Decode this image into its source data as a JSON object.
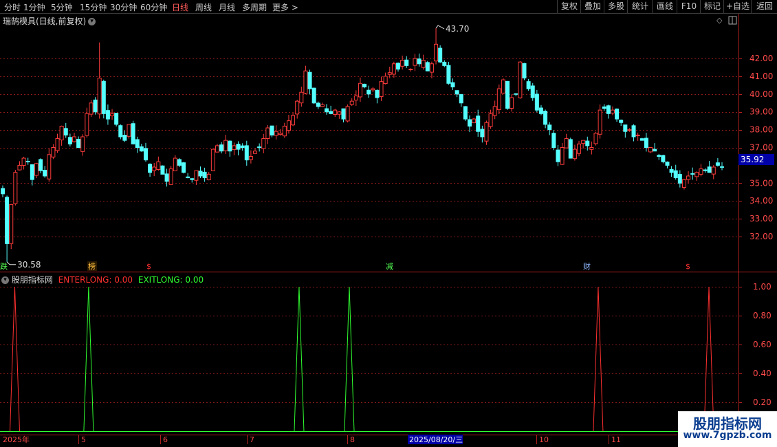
{
  "toolbar": {
    "periods": [
      "分时",
      "1分钟",
      "5分钟",
      "15分钟",
      "30分钟",
      "60分钟",
      "日线",
      "周线",
      "月线",
      "多周期",
      "更多 >"
    ],
    "active_period": "日线",
    "right_buttons": [
      "复权",
      "叠加",
      "多股",
      "统计",
      "画线",
      "F10",
      "标记",
      "+自选",
      "返回"
    ]
  },
  "main_chart": {
    "title": "瑞鹄模具(日线,前复权)",
    "y_axis_labels": [
      "42.00",
      "41.00",
      "40.00",
      "39.00",
      "38.00",
      "37.00",
      "35.00",
      "34.00",
      "33.00",
      "32.00"
    ],
    "high_label": "43.70",
    "low_label": "30.58",
    "current_price": "35.92",
    "event_markers": [
      "跌",
      "榜",
      "$",
      "减",
      "财",
      "$"
    ],
    "colors": {
      "up": "#ff3c3c",
      "down": "#54ffff",
      "grid": "#8b1a1a",
      "axis": "#b02020",
      "current_bg": "#0000a8"
    }
  },
  "indicator": {
    "name": "股朋指标网",
    "enter_label": "ENTERLONG: 0.00",
    "exit_label": "EXITLONG: 0.00",
    "y_axis_labels": [
      "1.00",
      "0.80",
      "0.60",
      "0.40",
      "0.20"
    ],
    "enter_color": "#ff3030",
    "exit_color": "#30ff30"
  },
  "time_axis": {
    "labels": [
      "2025年",
      "5",
      "6",
      "7",
      "8",
      "10",
      "11"
    ],
    "cursor_date": "2025/08/20/三"
  },
  "watermark": {
    "line1": "股朋指标网",
    "line2": "www.7gpzb.com"
  },
  "chart_data": {
    "type": "candlestick",
    "title": "瑞鹄模具(日线,前复权)",
    "ylim": [
      30.3,
      44.0
    ],
    "y_ticks": [
      32,
      33,
      34,
      35,
      37,
      38,
      39,
      40,
      41,
      42
    ],
    "period_high": 43.7,
    "period_low": 30.58,
    "last_price": 35.92,
    "close_series": [
      34.4,
      31.6,
      33.8,
      35.6,
      36.0,
      36.4,
      36.2,
      35.2,
      36.1,
      35.7,
      35.4,
      36.6,
      37.0,
      37.5,
      38.2,
      37.7,
      37.2,
      37.6,
      37.0,
      37.6,
      38.9,
      39.5,
      39.0,
      40.9,
      38.9,
      38.6,
      38.9,
      38.3,
      37.6,
      37.4,
      38.3,
      37.2,
      37.0,
      36.8,
      36.3,
      35.6,
      35.9,
      36.2,
      35.5,
      35.1,
      35.8,
      36.4,
      36.0,
      35.6,
      35.3,
      35.2,
      35.7,
      35.4,
      35.3,
      35.5,
      36.9,
      37.1,
      36.8,
      37.4,
      36.8,
      37.1,
      36.9,
      37.0,
      36.3,
      36.5,
      36.8,
      37.0,
      37.5,
      38.1,
      37.7,
      37.9,
      37.8,
      38.2,
      38.5,
      38.8,
      39.6,
      40.1,
      41.3,
      40.3,
      39.5,
      39.3,
      39.4,
      39.0,
      38.9,
      39.1,
      39.0,
      38.6,
      39.3,
      39.6,
      39.9,
      40.6,
      40.4,
      40.0,
      40.3,
      39.8,
      40.7,
      41.0,
      41.2,
      41.7,
      41.4,
      41.9,
      41.6,
      41.4,
      42.0,
      41.7,
      41.9,
      41.3,
      41.7,
      42.8,
      41.8,
      41.6,
      40.6,
      40.4,
      40.0,
      39.5,
      38.6,
      38.2,
      38.6,
      37.9,
      37.6,
      38.4,
      38.9,
      39.3,
      40.3,
      40.8,
      39.2,
      39.8,
      40.0,
      41.8,
      40.9,
      40.3,
      39.8,
      39.1,
      38.9,
      38.3,
      38.0,
      37.0,
      36.2,
      37.0,
      37.5,
      36.4,
      36.9,
      37.2,
      37.4,
      37.1,
      37.0,
      37.8,
      39.1,
      39.2,
      38.9,
      39.1,
      38.6,
      38.4,
      37.9,
      38.0,
      37.6,
      37.7,
      37.4,
      37.0,
      37.0,
      36.8,
      36.5,
      36.2,
      36.0,
      35.6,
      35.3,
      35.0,
      35.2,
      35.4,
      35.5,
      35.6,
      35.8,
      35.7,
      35.6,
      35.9,
      36.0,
      35.92
    ],
    "indicator_signals": {
      "ENTERLONG": [
        0.02,
        0.81,
        0.96
      ],
      "EXITLONG": [
        0.12,
        0.405,
        0.473
      ]
    },
    "indicator_ylim": [
      0,
      1.1
    ],
    "indicator_ticks": [
      0.2,
      0.4,
      0.6,
      0.8,
      1.0
    ]
  }
}
